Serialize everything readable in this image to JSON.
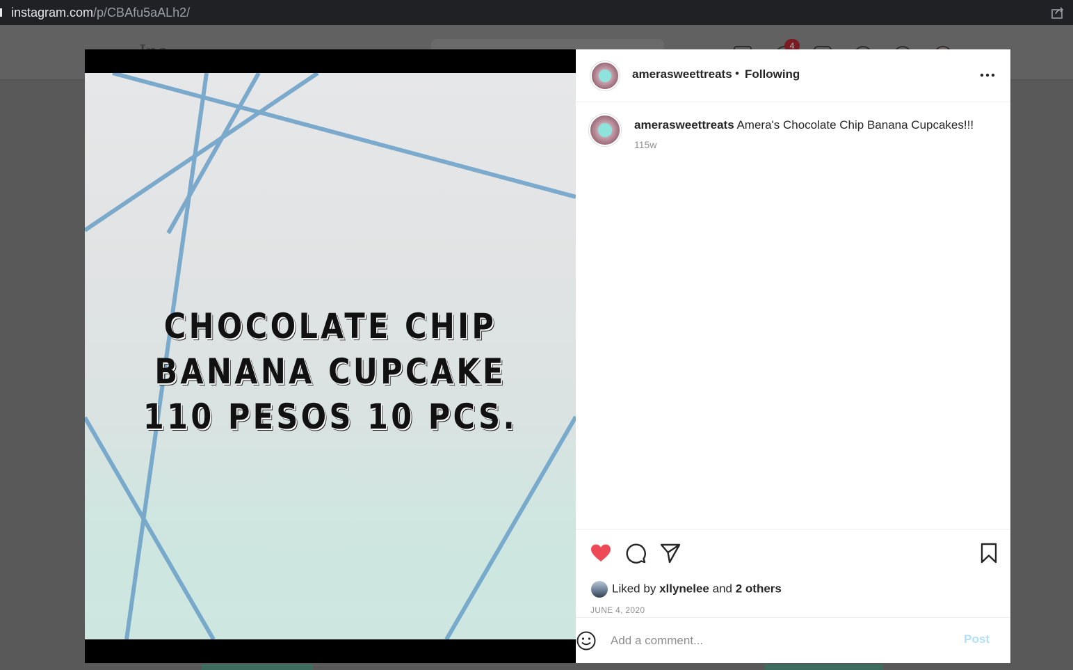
{
  "browser": {
    "url_host": "instagram.com",
    "url_path": "/p/CBAfu5aALh2/",
    "share_icon": "share-icon"
  },
  "background_page": {
    "notification_count": "4"
  },
  "post": {
    "image_text": {
      "line1": "CHOCOLATE CHIP",
      "line2": "BANANA CUPCAKE",
      "line3": "110 PESOS 10 PCS."
    },
    "header": {
      "username": "amerasweettreats",
      "separator": "•",
      "follow_status": "Following",
      "more_icon": "more-horizontal-icon"
    },
    "caption": {
      "username": "amerasweettreats",
      "text": "Amera's Chocolate Chip Banana Cupcakes!!!",
      "time": "115w"
    },
    "actions": {
      "like_icon": "heart-filled-icon",
      "comment_icon": "comment-icon",
      "share_icon": "send-icon",
      "save_icon": "bookmark-icon",
      "like_color": "#ed4956"
    },
    "likes": {
      "prefix": "Liked by",
      "user": "xllynelee",
      "connector": "and",
      "others": "2 others"
    },
    "date": "JUNE 4, 2020",
    "comment": {
      "placeholder": "Add a comment...",
      "post_label": "Post",
      "post_color": "#b2dffc"
    }
  }
}
